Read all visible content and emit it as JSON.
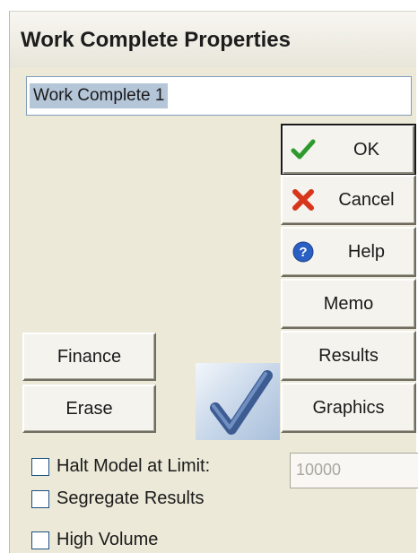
{
  "window": {
    "title": "Work Complete Properties"
  },
  "name_field": {
    "value": "Work Complete 1"
  },
  "buttons": {
    "ok": "OK",
    "cancel": "Cancel",
    "help": "Help",
    "memo": "Memo",
    "results": "Results",
    "graphics": "Graphics",
    "finance": "Finance",
    "erase": "Erase"
  },
  "options": {
    "halt_label": "Halt Model at Limit:",
    "halt_checked": false,
    "limit_value": "10000",
    "segregate_label": "Segregate Results",
    "segregate_checked": false,
    "high_volume_label": "High Volume",
    "high_volume_checked": false
  },
  "icons": {
    "ok": "green-checkmark-icon",
    "cancel": "red-x-icon",
    "help": "blue-question-icon",
    "badge": "work-complete-checkmark-icon"
  },
  "colors": {
    "ok_green": "#2e9a2e",
    "cancel_red": "#d8361b",
    "help_blue": "#2a5fc4",
    "badge_check": "#3d5c92"
  }
}
